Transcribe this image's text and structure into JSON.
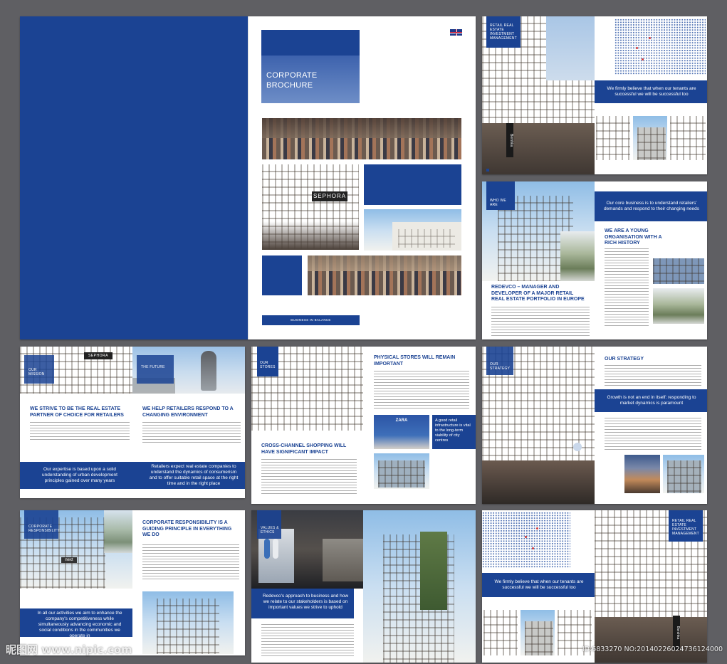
{
  "cover": {
    "title": "CORPORATE BROCHURE",
    "tagline": "BUSINESS IN BALANCE"
  },
  "spread2": {
    "tag": "RETAIL REAL ESTATE INVESTMENT MANAGEMENT",
    "quote": "We firmly believe that when our tenants are successful we will be successful too",
    "store_sign": "Bershka"
  },
  "spread3": {
    "tag": "WHO WE ARE",
    "quote": "Our core business is to understand retailers' demands and respond to their changing needs",
    "heading1": "WE ARE A YOUNG ORGANISATION WITH A RICH HISTORY",
    "heading2": "REDEVCO – MANAGER AND DEVELOPER OF A MAJOR RETAIL REAL ESTATE PORTFOLIO IN EUROPE"
  },
  "spread4": {
    "tag_left": "OUR MISSION",
    "tag_right": "THE FUTURE",
    "store_sign": "SEPHORA",
    "heading_left": "WE STRIVE TO BE THE REAL ESTATE PARTNER OF CHOICE FOR RETAILERS",
    "heading_right": "WE HELP RETAILERS RESPOND TO A CHANGING ENVIRONMENT",
    "quote_left": "Our expertise is based upon a solid understanding of urban development principles gained over many years",
    "quote_right": "Retailers expect real estate companies to understand the dynamics of consumerism and to offer suitable retail space at the right time and in the right place"
  },
  "spread5": {
    "tag": "OUR STORES",
    "heading_right": "PHYSICAL STORES WILL REMAIN IMPORTANT",
    "heading_left": "CROSS-CHANNEL SHOPPING WILL HAVE SIGNIFICANT IMPACT",
    "quote": "A good retail infrastructure is vital to the long-term viability of city centres",
    "store_sign": "ZARA"
  },
  "spread6": {
    "tag": "OUR STRATEGY",
    "heading": "OUR STRATEGY",
    "quote": "Growth is not an end in itself: responding to market dynamics is paramount"
  },
  "spread7": {
    "tag": "CORPORATE RESPONSIBILITY",
    "heading": "CORPORATE RESPONSIBILITY IS A GUIDING PRINCIPLE IN EVERYTHING WE DO",
    "quote": "In all our activities we aim to enhance the company's competitiveness while simultaneously advancing economic and social conditions in the communities we operate in",
    "store_sign": "next"
  },
  "spread8": {
    "tag": "VALUES & ETHICS",
    "quote": "Redevco's approach to business and how we relate to our stakeholders is based on important values we strive to uphold"
  },
  "spread9": {
    "tag": "RETAIL REAL ESTATE INVESTMENT MANAGEMENT",
    "quote": "We firmly believe that when our tenants are successful we will be successful too",
    "store_sign": "Bershka"
  },
  "watermark": {
    "left": "昵图网 www.nipic.com",
    "right": "ID:6833270 NO:20140226024736124000"
  },
  "colors": {
    "brand_blue": "#1b4393",
    "background": "#5f5f63"
  }
}
